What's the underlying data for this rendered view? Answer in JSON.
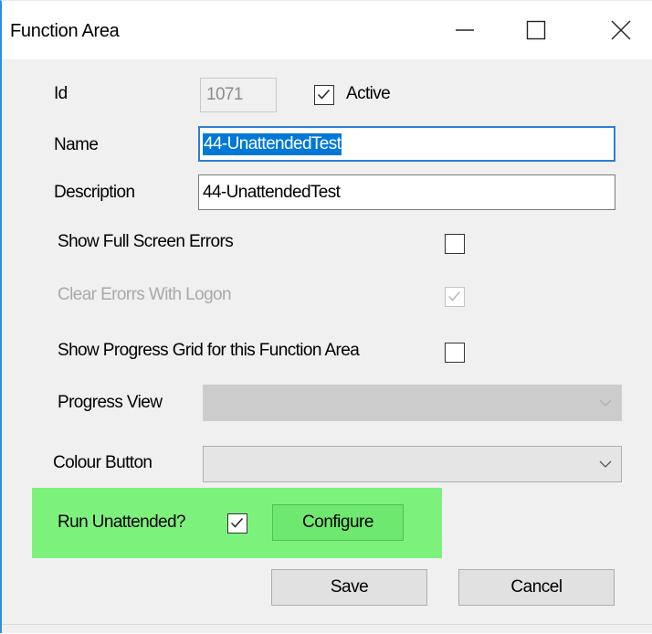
{
  "window": {
    "title": "Function Area",
    "controls": [
      "minimize-icon",
      "maximize-icon",
      "close-icon"
    ]
  },
  "form": {
    "id_label": "Id",
    "id_value": "1071",
    "active_label": "Active",
    "active_checked": true,
    "name_label": "Name",
    "name_value": "44-UnattendedTest",
    "description_label": "Description",
    "description_value": "44-UnattendedTest",
    "show_full_screen_errors_label": "Show Full Screen Errors",
    "show_full_screen_errors_checked": false,
    "clear_errors_label": "Clear Erorrs With Logon",
    "clear_errors_checked": true,
    "show_progress_grid_label": "Show Progress Grid for this Function Area",
    "show_progress_grid_checked": false,
    "progress_view_label": "Progress View",
    "progress_view_value": "",
    "colour_button_label": "Colour Button",
    "colour_button_value": "",
    "run_unattended_label": "Run Unattended?",
    "run_unattended_checked": true,
    "configure_label": "Configure"
  },
  "actions": {
    "save_label": "Save",
    "cancel_label": "Cancel"
  },
  "colors": {
    "highlight": "#7cf27c",
    "accent": "#2b90d9"
  }
}
